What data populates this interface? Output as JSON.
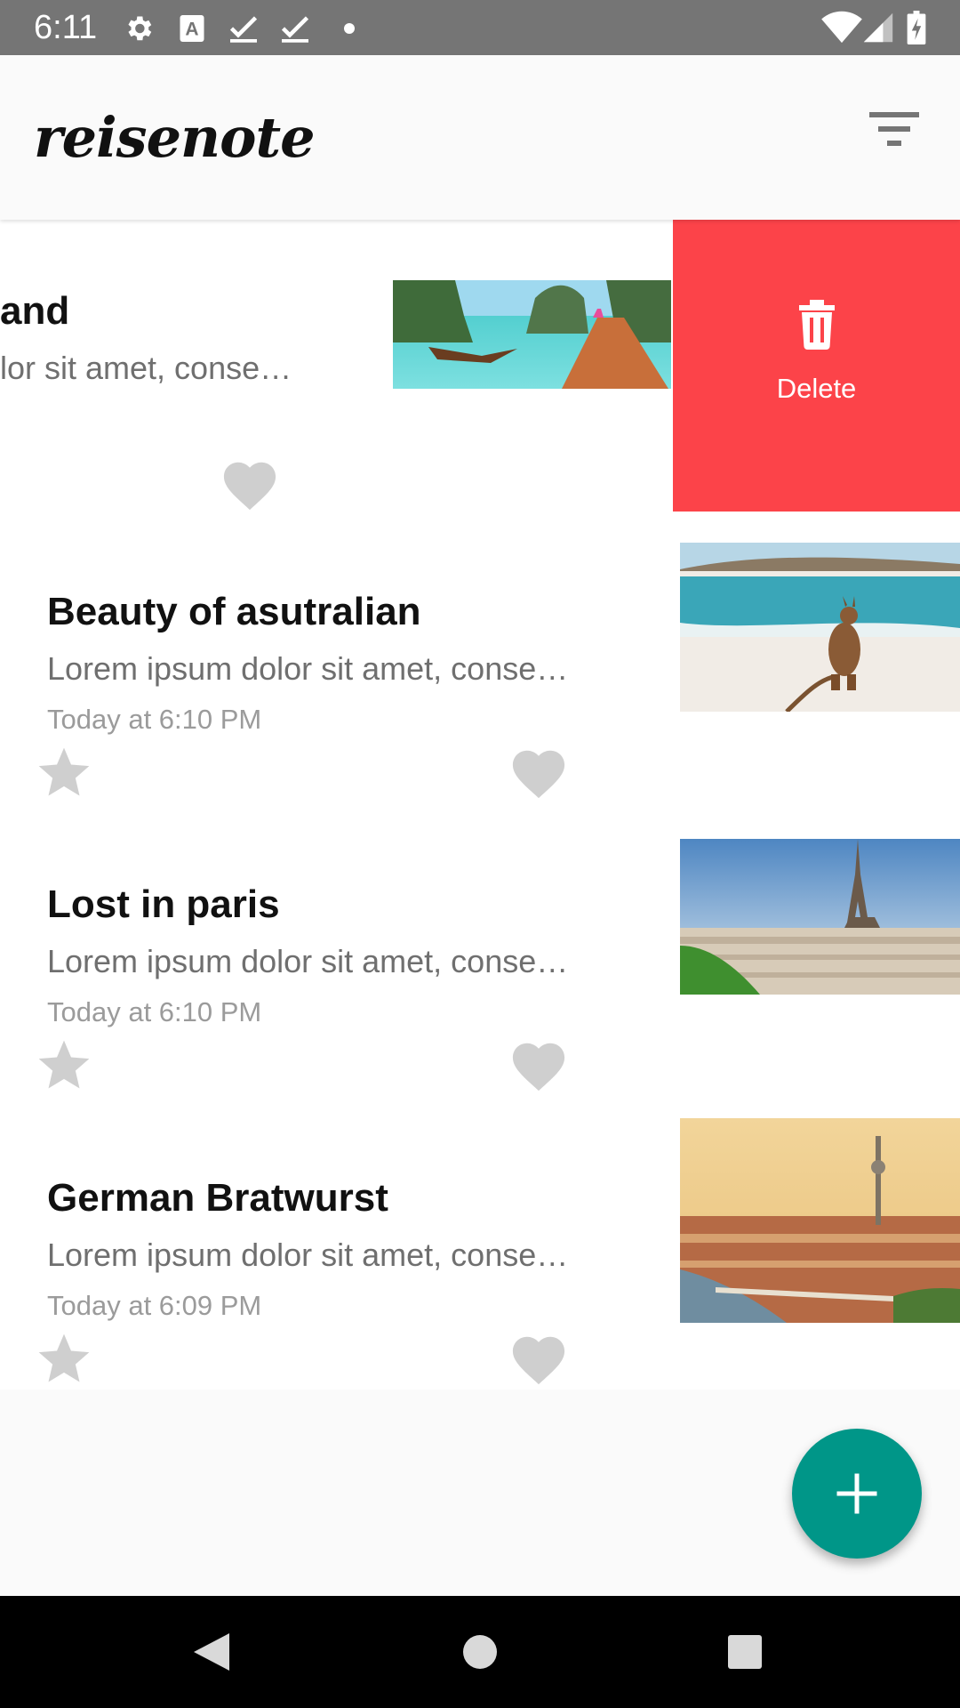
{
  "status_bar": {
    "time": "6:11",
    "icons": [
      "gear-icon",
      "font-icon",
      "check-icon",
      "check-icon",
      "dot-icon",
      "wifi-icon",
      "signal-icon",
      "battery-charging-icon"
    ]
  },
  "app_bar": {
    "logo_text": "reisenote",
    "filter_icon": "filter-icon"
  },
  "notes": [
    {
      "title": "Thailand",
      "title_visible": "and",
      "excerpt": "Lorem ipsum dolor sit amet, conse…",
      "excerpt_visible": "lor sit amet, conse…",
      "date": "",
      "image": "thailand-boats-photo",
      "swiped": true
    },
    {
      "title": "Beauty of asutralian",
      "excerpt": "Lorem ipsum dolor sit amet, conse…",
      "date": "Today at 6:10 PM",
      "image": "kangaroo-beach-photo"
    },
    {
      "title": "Lost in paris",
      "excerpt": "Lorem ipsum dolor sit amet, conse…",
      "date": "Today at 6:10 PM",
      "image": "paris-eiffel-photo"
    },
    {
      "title": "German Bratwurst",
      "excerpt": "Lorem ipsum dolor sit amet, conse…",
      "date": "Today at 6:09 PM",
      "image": "berlin-city-photo"
    }
  ],
  "delete_action": {
    "label": "Delete",
    "icon": "trash-icon",
    "color": "#fc4349"
  },
  "fab": {
    "icon": "plus-icon",
    "color": "#009688"
  },
  "nav_bar": {
    "buttons": [
      "back-icon",
      "home-icon",
      "recents-icon"
    ]
  },
  "colors": {
    "accent": "#009688",
    "delete": "#fc4349",
    "icon_gray": "#cfcfcf",
    "status_bar": "#757575"
  }
}
